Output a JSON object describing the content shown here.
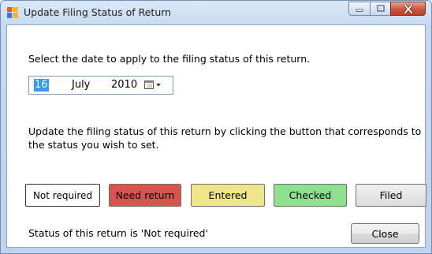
{
  "window": {
    "title": "Update Filing Status of Return"
  },
  "instructions": {
    "date_prompt": "Select the date to apply to the filing status of this return.",
    "status_prompt_line1": "Update the filing status of this return by clicking the button that corresponds to",
    "status_prompt_line2": "the status you wish to set."
  },
  "date_picker": {
    "day": "16",
    "month": "July",
    "year": "2010",
    "icon": "calendar-dropdown-icon"
  },
  "status_buttons": [
    {
      "label": "Not required",
      "color": "#ffffff",
      "selected": true
    },
    {
      "label": "Need return",
      "color": "#d9534f"
    },
    {
      "label": "Entered",
      "color": "#efe58a"
    },
    {
      "label": "Checked",
      "color": "#8de08d"
    },
    {
      "label": "Filed",
      "color": "#dcdcdc"
    }
  ],
  "status_text": "Status of this return is 'Not required'",
  "close_label": "Close",
  "icons": {
    "app": "app-window-icon",
    "minimize": "minimize-icon",
    "maximize": "maximize-icon",
    "close": "close-icon"
  }
}
